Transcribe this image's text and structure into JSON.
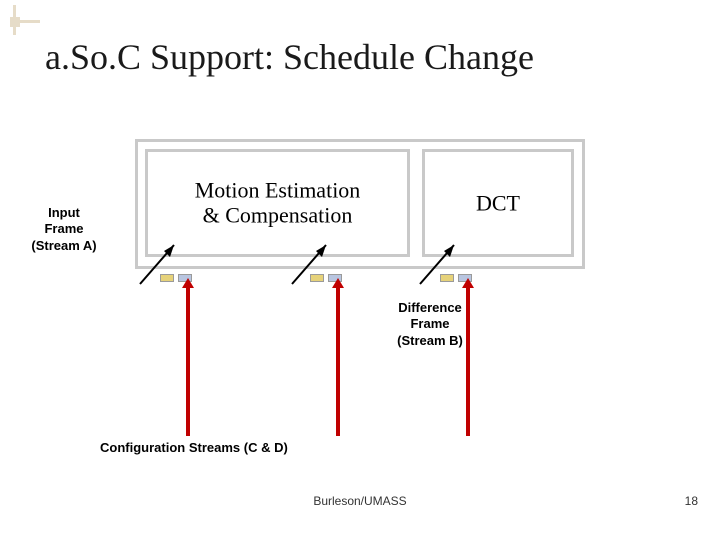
{
  "title": "a.So.C Support: Schedule Change",
  "blocks": {
    "motion": "Motion Estimation\n& Compensation",
    "dct": "DCT"
  },
  "labels": {
    "input": "Input\nFrame\n(Stream A)",
    "difference": "Difference\nFrame\n(Stream B)",
    "config": "Configuration Streams (C & D)"
  },
  "footer": {
    "center": "Burleson/UMASS",
    "page": "18"
  }
}
